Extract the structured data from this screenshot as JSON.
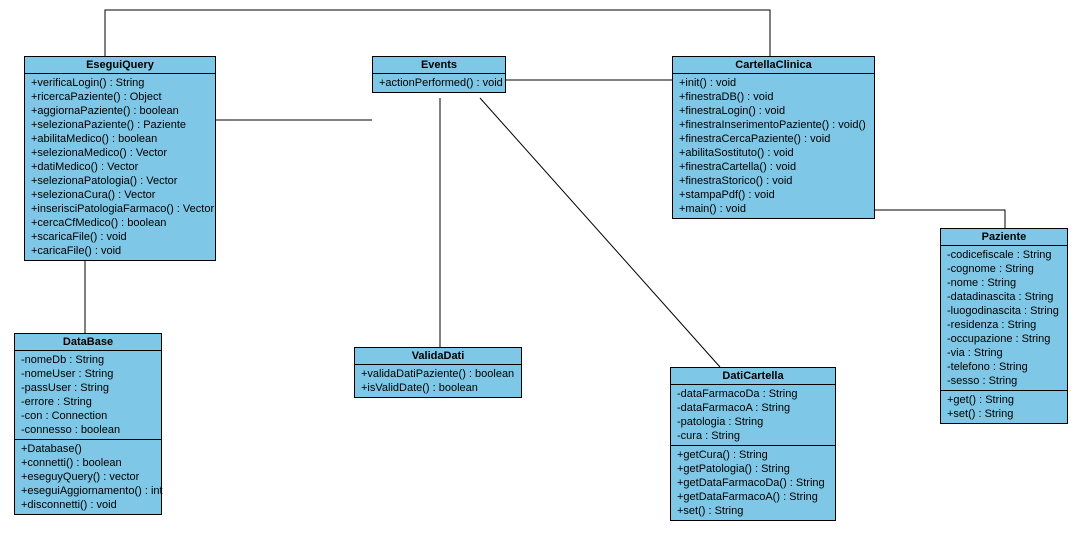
{
  "classes": {
    "eseguiQuery": {
      "name": "EseguiQuery",
      "attrs": [],
      "ops": [
        "+verificaLogin() : String",
        "+ricercaPaziente() : Object",
        "+aggiornaPaziente() : boolean",
        "+selezionaPaziente() : Paziente",
        "+abilitaMedico() : boolean",
        "+selezionaMedico() : Vector",
        "+datiMedico() : Vector",
        "+selezionaPatologia() : Vector",
        "+selezionaCura() : Vector",
        "+inserisciPatologiaFarmaco() : Vector",
        "+cercaCfMedico() : boolean",
        "+scaricaFile() : void",
        "+caricaFile() : void"
      ]
    },
    "events": {
      "name": "Events",
      "attrs": [],
      "ops": [
        "+actionPerformed() : void"
      ]
    },
    "cartellaClinica": {
      "name": "CartellaClinica",
      "attrs": [],
      "ops": [
        "+init() : void",
        "+finestraDB() : void",
        "+finestraLogin() : void",
        "+finestraInserimentoPaziente() : void()",
        "+finestraCercaPaziente() : void",
        "+abilitaSostituto() : void",
        "+finestraCartella() : void",
        "+finestraStorico() : void",
        "+stampaPdf() : void",
        "+main() : void"
      ]
    },
    "paziente": {
      "name": "Paziente",
      "attrs": [
        "-codicefiscale : String",
        "-cognome : String",
        "-nome : String",
        "-datadinascita : String",
        "-luogodinascita : String",
        "-residenza : String",
        "-occupazione : String",
        "-via : String",
        "-telefono : String",
        "-sesso : String"
      ],
      "ops": [
        "+get() : String",
        "+set() : String"
      ]
    },
    "dataBase": {
      "name": "DataBase",
      "attrs": [
        "-nomeDb : String",
        "-nomeUser : String",
        "-passUser : String",
        "-errore : String",
        "-con : Connection",
        "-connesso : boolean"
      ],
      "ops": [
        "+Database()",
        "+connetti() : boolean",
        "+eseguyQuery() : vector",
        "+eseguiAggiornamento() : int",
        "+disconnetti() : void"
      ]
    },
    "validaDati": {
      "name": "ValidaDati",
      "attrs": [],
      "ops": [
        "+validaDatiPaziente() : boolean",
        "+isValidDate() : boolean"
      ]
    },
    "datiCartella": {
      "name": "DatiCartella",
      "attrs": [
        "-dataFarmacoDa : String",
        "-dataFarmacoA : String",
        "-patologia : String",
        "-cura : String"
      ],
      "ops": [
        "+getCura() : String",
        "+getPatologia() : String",
        "+getDataFarmacoDa() : String",
        "+getDataFarmacoA() : String",
        "+set() : String"
      ]
    }
  }
}
